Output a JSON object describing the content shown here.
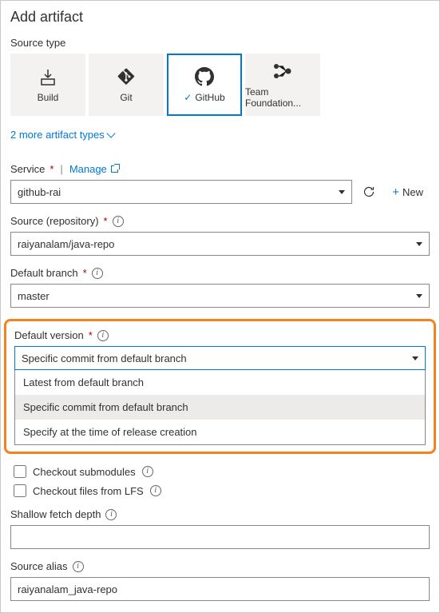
{
  "title": "Add artifact",
  "sourceType": {
    "label": "Source type",
    "tiles": [
      {
        "name": "build",
        "label": "Build"
      },
      {
        "name": "git",
        "label": "Git"
      },
      {
        "name": "github",
        "label": "GitHub",
        "selected": true
      },
      {
        "name": "tfvc",
        "label": "Team Foundation..."
      }
    ],
    "moreLink": "2 more artifact types"
  },
  "service": {
    "label": "Service",
    "manage": "Manage",
    "value": "github-rai",
    "newLabel": "New"
  },
  "repo": {
    "label": "Source (repository)",
    "value": "raiyanalam/java-repo"
  },
  "branch": {
    "label": "Default branch",
    "value": "master"
  },
  "version": {
    "label": "Default version",
    "value": "Specific commit from default branch",
    "options": [
      "Latest from default branch",
      "Specific commit from default branch",
      "Specify at the time of release creation"
    ]
  },
  "checkboxes": {
    "submodules": "Checkout submodules",
    "lfs": "Checkout files from LFS"
  },
  "shallow": {
    "label": "Shallow fetch depth",
    "value": ""
  },
  "alias": {
    "label": "Source alias",
    "value": "raiyanalam_java-repo"
  }
}
